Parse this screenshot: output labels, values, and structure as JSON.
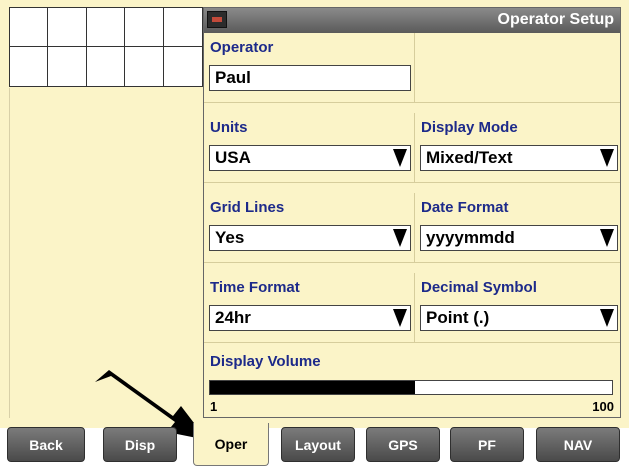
{
  "window": {
    "title": "Operator Setup",
    "icon": "monitor-icon"
  },
  "fields": {
    "operator": {
      "label": "Operator",
      "value": "Paul"
    },
    "units": {
      "label": "Units",
      "value": "USA"
    },
    "display_mode": {
      "label": "Display Mode",
      "value": "Mixed/Text"
    },
    "grid_lines": {
      "label": "Grid Lines",
      "value": "Yes"
    },
    "date_format": {
      "label": "Date Format",
      "value": "yyyymmdd"
    },
    "time_format": {
      "label": "Time Format",
      "value": "24hr"
    },
    "decimal_symbol": {
      "label": "Decimal Symbol",
      "value": "Point (.)"
    }
  },
  "volume": {
    "label": "Display Volume",
    "min": "1",
    "max": "100",
    "level_fraction": 0.51
  },
  "tabs": [
    {
      "label": "Back",
      "active": false
    },
    {
      "label": "Disp",
      "active": false
    },
    {
      "label": "Oper",
      "active": true
    },
    {
      "label": "Layout",
      "active": false
    },
    {
      "label": "GPS",
      "active": false
    },
    {
      "label": "PF",
      "active": false
    },
    {
      "label": "NAV",
      "active": false
    }
  ],
  "colors": {
    "background": "#fbf4c8",
    "label": "#1d2a8a",
    "tab": "#5a5a5a"
  }
}
